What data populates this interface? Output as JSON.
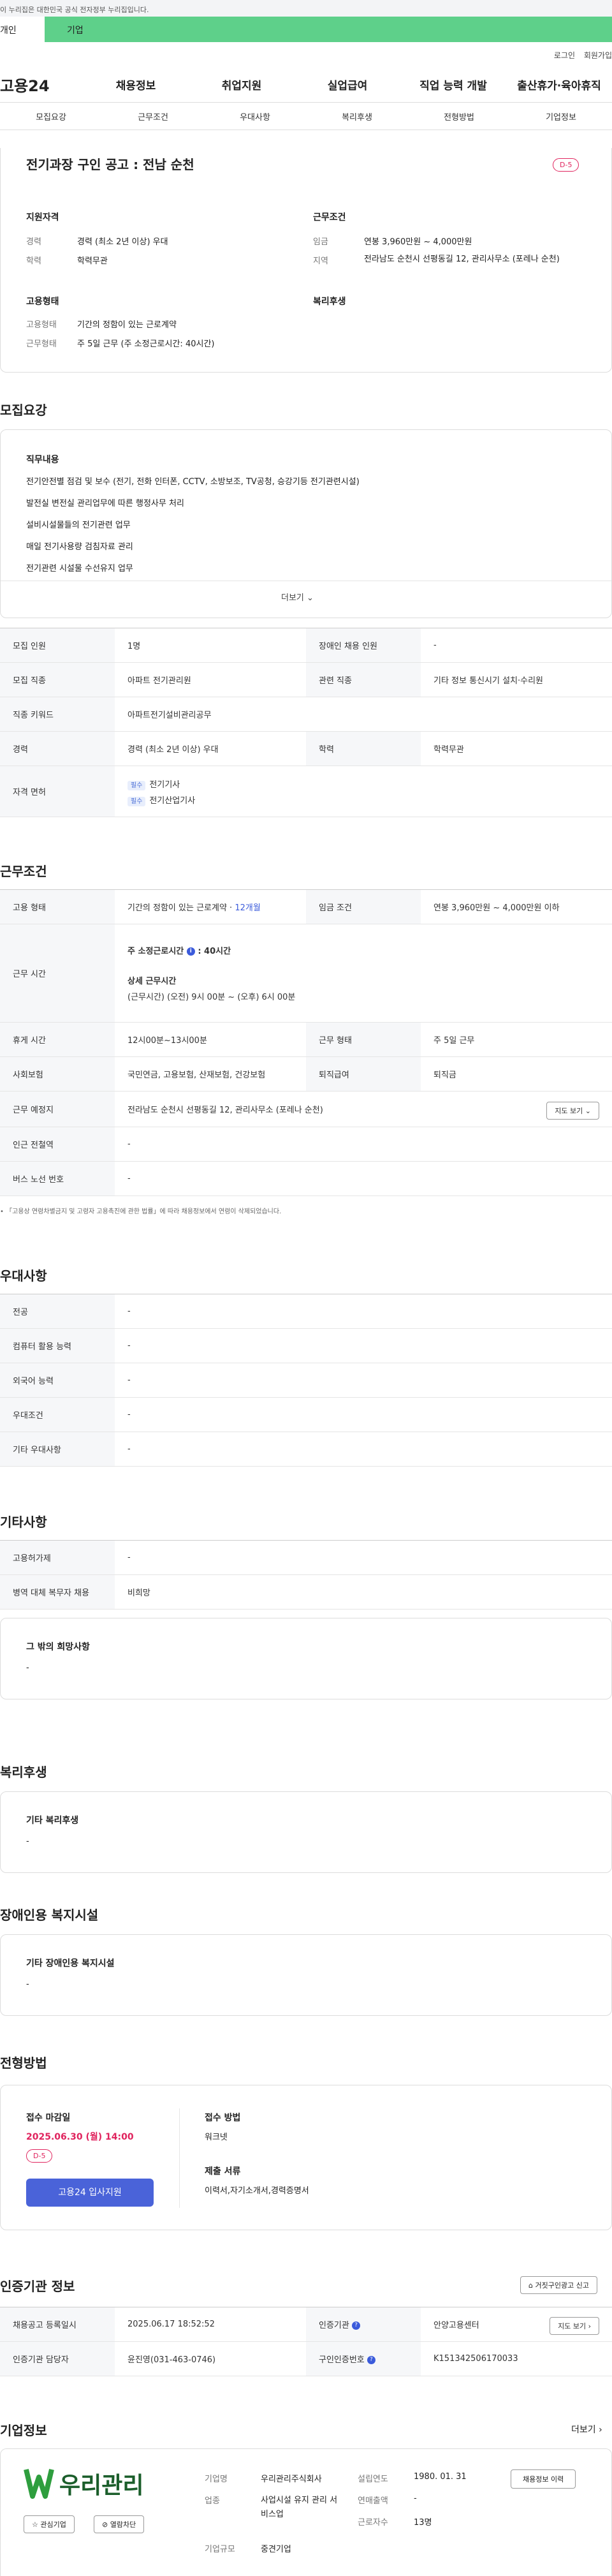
{
  "topbar": {
    "notice": "이 누리집은 대한민국 공식 전자정부 누리집입니다."
  },
  "audience": {
    "personal": "개인",
    "company": "기업"
  },
  "util": {
    "login": "로그인",
    "join": "회원가입"
  },
  "gnb": {
    "logo": "고용24",
    "items": [
      "채용정보",
      "취업지원",
      "실업급여",
      "직업 능력 개발",
      "출산휴가·육아휴직"
    ]
  },
  "subnav": [
    "모집요강",
    "근무조건",
    "우대사항",
    "복리후생",
    "전형방법",
    "기업정보"
  ],
  "job": {
    "title": "전기과장 구인 공고 : 전남 순천",
    "dday": "D-5",
    "qual_title": "지원자격",
    "qual": [
      {
        "label": "경력",
        "value": "경력 (최소 2년 이상) 우대"
      },
      {
        "label": "학력",
        "value": "학력무관"
      }
    ],
    "cond_title": "근무조건",
    "cond": [
      {
        "label": "임금",
        "value": "연봉 3,960만원 ~ 4,000만원"
      },
      {
        "label": "지역",
        "value": "전라남도 순천시 선평동길 12, 관리사무소 (포레나 순천)"
      }
    ],
    "emp_title": "고용형태",
    "emp": [
      {
        "label": "고용형태",
        "value": "기간의 정함이 있는 근로계약"
      },
      {
        "label": "근무형태",
        "value": "주 5일 근무 (주 소정근로시간: 40시간)"
      }
    ],
    "welfare_title": "복리후생"
  },
  "recruit": {
    "title": "모집요강",
    "duty_title": "직무내용",
    "duties": [
      "전기안전별 점검 및 보수 (전기, 전화 인터폰, CCTV, 소방보조, TV공청, 승강기등 전기관련시설)",
      "발전실 변전실 관리업무에 따른 행정사무 처리",
      "설비시설물들의 전기관련 업무",
      "매일 전기사용량 검침자료 관리",
      "전기관련 시설물 수선유지 업무"
    ],
    "more": "더보기",
    "table": {
      "headcount_l": "모집 인원",
      "headcount": "1명",
      "disabled_l": "장애인 채용 인원",
      "disabled": "-",
      "job_l": "모집 직종",
      "job": "아파트 전기관리원",
      "related_l": "관련 직종",
      "related": "기타 정보 통신시기 설치·수리원",
      "keyword_l": "직종 키워드",
      "keyword": "아파트전기설비관리공무",
      "career_l": "경력",
      "career": "경력 (최소 2년 이상) 우대",
      "edu_l": "학력",
      "edu": "학력무관",
      "license_l": "자격 면허",
      "licenses": [
        {
          "tag": "필수",
          "name": "전기기사"
        },
        {
          "tag": "필수",
          "name": "전기산업기사"
        }
      ]
    }
  },
  "workcond": {
    "title": "근무조건",
    "emp_l": "고용 형태",
    "emp": "기간의 정함이 있는 근로계약 ·",
    "emp_period": "12개월",
    "wage_l": "임금 조건",
    "wage": "연봉 3,960만원 ~ 4,000만원 이하",
    "hours_l": "근무 시간",
    "weekly_l": "주 소정근로시간",
    "weekly": ": 40시간",
    "detail_l": "상세 근무시간",
    "detail": "(근무시간) (오전) 9시 00분 ~ (오후) 6시 00분",
    "break_l": "휴게 시간",
    "break": "12시00분~13시00분",
    "type_l": "근무 형태",
    "type": "주 5일 근무",
    "insurance_l": "사회보험",
    "insurance": "국민연금, 고용보험, 산재보험, 건강보험",
    "retire_l": "퇴직급여",
    "retire": "퇴직금",
    "place_l": "근무 예정지",
    "place": "전라남도 순천시 선평동길 12, 관리사무소 (포레나 순천)",
    "map": "지도 보기",
    "subway_l": "인근 전철역",
    "subway": "-",
    "bus_l": "버스 노선 번호",
    "bus": "-",
    "note": "「고용상 연령차별금지 및 고령자 고용촉진에 관한 법률」에 따라 채용정보에서 연령이 삭제되었습니다."
  },
  "pref": {
    "title": "우대사항",
    "rows": [
      {
        "label": "전공",
        "value": "-"
      },
      {
        "label": "컴퓨터 활용 능력",
        "value": "-"
      },
      {
        "label": "외국어 능력",
        "value": "-"
      },
      {
        "label": "우대조건",
        "value": "-"
      },
      {
        "label": "기타 우대사항",
        "value": "-"
      }
    ]
  },
  "etc": {
    "title": "기타사항",
    "rows": [
      {
        "label": "고용허가제",
        "value": "-"
      },
      {
        "label": "병역 대체 복무자 채용",
        "value": "비희망"
      }
    ],
    "other_title": "그 밖의 희망사항",
    "other": "-"
  },
  "welfare": {
    "title": "복리후생",
    "box_title": "기타 복리후생",
    "box": "-"
  },
  "facility": {
    "title": "장애인용 복지시설",
    "box_title": "기타 장애인용 복지시설",
    "box": "-"
  },
  "process": {
    "title": "전형방법",
    "deadline_l": "접수 마감일",
    "deadline": "2025.06.30 (월) 14:00",
    "dday": "D-5",
    "apply": "고용24 입사지원",
    "method_l": "접수 방법",
    "method": "워크넷",
    "docs_l": "제출 서류",
    "docs": "이력서,자기소개서,경력증명서"
  },
  "cert": {
    "title": "인증기관 정보",
    "report": "거짓구인광고 신고",
    "reg_l": "채용공고 등록일시",
    "reg": "2025.06.17 18:52:52",
    "org_l": "인증기관",
    "org": "안양고용센터",
    "map": "지도 보기",
    "mgr_l": "인증기관 담당자",
    "mgr": "윤진영(031-463-0746)",
    "no_l": "구인인증번호",
    "no": "K151342506170033"
  },
  "company": {
    "title": "기업정보",
    "more": "더보기",
    "logo": "우리관리",
    "fav": "관심기업",
    "block": "열람차단",
    "name_l": "기업명",
    "name": "우리관리주식회사",
    "year_l": "설립연도",
    "year": "1980. 01. 31",
    "jobs": "채용정보 이력",
    "biz_l": "업종",
    "biz": "사업시설 유지 관리 서비스업",
    "sales_l": "연매출액",
    "sales": "-",
    "emp_l": "근로자수",
    "emp": "13명",
    "size_l": "기업규모",
    "size": "중견기업"
  },
  "colors": {
    "accent": "#3b5bdb",
    "green": "#5ed08a",
    "red": "#e0245e"
  }
}
